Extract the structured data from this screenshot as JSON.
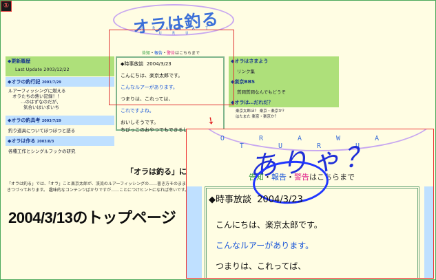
{
  "corner_icon": "①",
  "logo": {
    "title": "オラは釣る",
    "romaji": "O R A W A T U R U"
  },
  "notice": {
    "part1": "告知",
    "sep1": "・",
    "part2": "報告",
    "sep2": "・",
    "part3": "警告",
    "part4": "はこちらまで"
  },
  "sidebar_left": [
    {
      "head": "◆更新履歴",
      "body": "Last Update 2003/12/22"
    },
    {
      "head": "◆オラの釣行記",
      "body_lines": [
        "ルアーフィッシングに燃える",
        "オラたちの熱い記録！！",
        "…のはずなのだが、",
        "気合いはいまいち"
      ],
      "date": "2003/7/29"
    },
    {
      "head": "◆オラの釣具考",
      "body": "釣り道具についてぼつぼつと語る",
      "date": "2003/7/29"
    },
    {
      "head": "◆オラは作る",
      "body": "各種工作とシングルフックの研究",
      "date": "2003/8/3"
    }
  ],
  "sidebar_right": [
    {
      "head": "◆オラはさまよう",
      "body": "リンク集"
    },
    {
      "head": "◆楽京BBS",
      "body": "質問質問なんでもどうぞ"
    },
    {
      "head": "◆オラは…だれだ？",
      "body_lines": [
        "楽京太郎ほ？ 楽京・楽京か？",
        "はたまた 楽京・楽京か？"
      ]
    }
  ],
  "news_small": {
    "title": "◆時事放談",
    "date": "2004/3/23",
    "lines": [
      "こんにちは、楽京太郎です。",
      "こんなルアーがあります。",
      "つまりは、これっては、",
      "これですよね。",
      "おいしそうです。",
      "ちびっこのおやつでもできるし"
    ]
  },
  "bottom": {
    "title": "「オラは釣る」に…",
    "para": "「オラは釣る」では、「オラ」こと楽京太郎が、渓流のルアーフィッシングの……書き方そのまま書きつづっております。 趣味的なコンテンツばかりですが……ことにつけヒントになれば幸いです。"
  },
  "caption": "2004/3/13のトップページ",
  "zoom": {
    "romaji": "O R A W A T U R U",
    "scribble": "ありゃ？",
    "news_title": "◆時事放談",
    "news_date": "2004/3/23",
    "line1": "こんにちは、楽京太郎です。",
    "line2": "こんなルアーがあります。",
    "line3": "つまりは、これってば、"
  },
  "colors": {
    "background": "#fffde3",
    "highlight_red": "#e03030",
    "green_head": "#aee07a",
    "blue_head": "#bfe0ff",
    "scribble_blue": "#1f2fd8"
  }
}
